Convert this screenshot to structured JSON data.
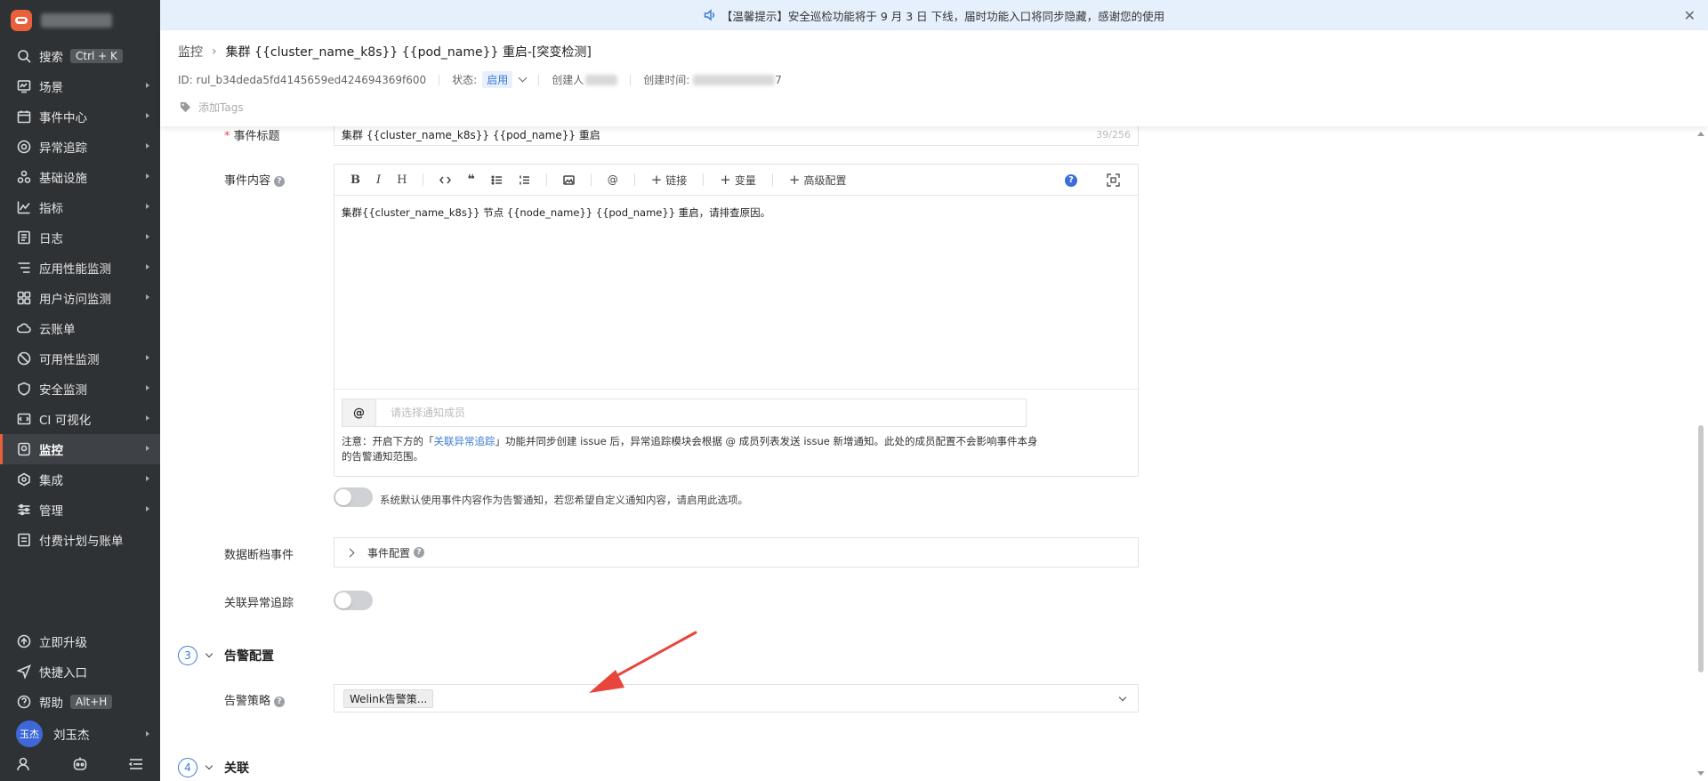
{
  "sidebar": {
    "items": [
      {
        "label": "搜索",
        "icon": "search-icon",
        "kbd": "Ctrl + K",
        "arrow": false
      },
      {
        "label": "场景",
        "icon": "scene-icon",
        "arrow": true
      },
      {
        "label": "事件中心",
        "icon": "event-icon",
        "arrow": true
      },
      {
        "label": "异常追踪",
        "icon": "issue-icon",
        "arrow": true
      },
      {
        "label": "基础设施",
        "icon": "infra-icon",
        "arrow": true
      },
      {
        "label": "指标",
        "icon": "metric-icon",
        "arrow": true
      },
      {
        "label": "日志",
        "icon": "log-icon",
        "arrow": true
      },
      {
        "label": "应用性能监测",
        "icon": "apm-icon",
        "arrow": true
      },
      {
        "label": "用户访问监测",
        "icon": "rum-icon",
        "arrow": true
      },
      {
        "label": "云账单",
        "icon": "cloud-bill-icon",
        "arrow": false
      },
      {
        "label": "可用性监测",
        "icon": "dialing-icon",
        "arrow": true
      },
      {
        "label": "安全监测",
        "icon": "security-icon",
        "arrow": true
      },
      {
        "label": "CI 可视化",
        "icon": "ci-icon",
        "arrow": true
      },
      {
        "label": "监控",
        "icon": "monitor-icon",
        "arrow": true,
        "active": true
      },
      {
        "label": "集成",
        "icon": "integration-icon",
        "arrow": true
      },
      {
        "label": "管理",
        "icon": "manage-icon",
        "arrow": true
      },
      {
        "label": "付费计划与账单",
        "icon": "billing-icon",
        "arrow": false
      }
    ],
    "bottom": {
      "upgrade": "立即升级",
      "shortcut": "快捷入口",
      "help": "帮助",
      "help_kbd": "Alt+H",
      "avatar_text": "玉杰",
      "user_name": "刘玉杰"
    }
  },
  "notice": {
    "text": "【温馨提示】安全巡检功能将于 9 月 3 日 下线，届时功能入口将同步隐藏，感谢您的使用"
  },
  "header": {
    "breadcrumb_parent": "监控",
    "breadcrumb_title": "集群 {{cluster_name_k8s}} {{pod_name}} 重启-[突变检测]",
    "rule_id": "ID: rul_b34deda5fd4145659ed424694369f600",
    "status_label": "状态:",
    "status_value": "启用",
    "creator_label": "创建人",
    "created_label": "创建时间:",
    "created_tail": "7",
    "tags_placeholder": "添加Tags"
  },
  "form": {
    "event_title_label": "事件标题",
    "event_title_value": "集群 {{cluster_name_k8s}} {{pod_name}} 重启",
    "event_title_count": "39/256",
    "event_content_label": "事件内容",
    "toolbar": {
      "bold": "B",
      "italic": "I",
      "heading": "H",
      "link": "链接",
      "variable": "变量",
      "advanced": "高级配置",
      "help": "?"
    },
    "event_content_value": "集群{{cluster_name_k8s}} 节点 {{node_name}} {{pod_name}} 重启，请排查原因。",
    "mention_at": "@",
    "mention_placeholder": "请选择通知成员",
    "mention_note_prefix": "注意：开启下方的「",
    "mention_note_link": "关联异常追踪",
    "mention_note_suffix": "」功能并同步创建 issue 后，异常追踪模块会根据 @ 成员列表发送 issue 新增通知。此处的成员配置不会影响事件本身的告警通知范围。",
    "custom_notify_desc": "系统默认使用事件内容作为告警通知，若您希望自定义通知内容，请启用此选项。",
    "data_gap_label": "数据断档事件",
    "event_config_label": "事件配置",
    "link_issue_label": "关联异常追踪"
  },
  "sections": {
    "alert": {
      "step": "3",
      "title": "告警配置"
    },
    "relation": {
      "step": "4",
      "title": "关联"
    }
  },
  "alert": {
    "policy_label": "告警策略",
    "policy_value": "Welink告警策..."
  },
  "colors": {
    "sidebar_bg": "#2f3235",
    "accent": "#3a7bd5",
    "active_marker": "#e8603c",
    "annotation_arrow": "#e8453c"
  }
}
